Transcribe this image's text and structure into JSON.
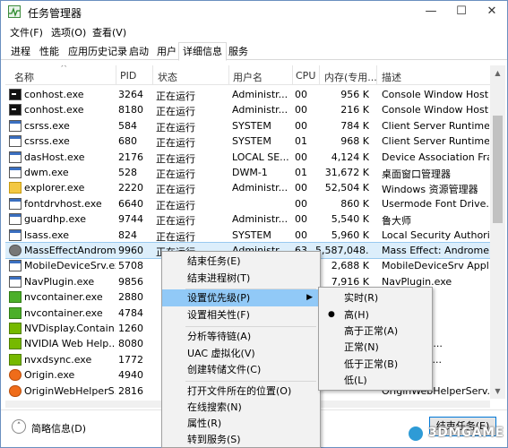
{
  "window": {
    "title": "任务管理器",
    "controls": [
      "—",
      "☐",
      "✕"
    ]
  },
  "menubar": [
    "文件(F)",
    "选项(O)",
    "查看(V)"
  ],
  "tabs": [
    "进程",
    "性能",
    "应用历史记录",
    "启动",
    "用户",
    "详细信息",
    "服务"
  ],
  "active_tab": "详细信息",
  "columns": [
    "名称",
    "PID",
    "状态",
    "用户名",
    "CPU",
    "内存(专用...",
    "描述"
  ],
  "rows": [
    {
      "icon": "console",
      "name": "conhost.exe",
      "pid": "3264",
      "status": "正在运行",
      "user": "Administr...",
      "cpu": "00",
      "mem": "956 K",
      "desc": "Console Window Host"
    },
    {
      "icon": "console",
      "name": "conhost.exe",
      "pid": "8180",
      "status": "正在运行",
      "user": "Administr...",
      "cpu": "00",
      "mem": "216 K",
      "desc": "Console Window Host"
    },
    {
      "icon": "box",
      "name": "csrss.exe",
      "pid": "584",
      "status": "正在运行",
      "user": "SYSTEM",
      "cpu": "00",
      "mem": "784 K",
      "desc": "Client Server Runtime ..."
    },
    {
      "icon": "box",
      "name": "csrss.exe",
      "pid": "680",
      "status": "正在运行",
      "user": "SYSTEM",
      "cpu": "01",
      "mem": "968 K",
      "desc": "Client Server Runtime ..."
    },
    {
      "icon": "box",
      "name": "dasHost.exe",
      "pid": "2176",
      "status": "正在运行",
      "user": "LOCAL SE...",
      "cpu": "00",
      "mem": "4,124 K",
      "desc": "Device Association Fra..."
    },
    {
      "icon": "box",
      "name": "dwm.exe",
      "pid": "528",
      "status": "正在运行",
      "user": "DWM-1",
      "cpu": "01",
      "mem": "31,672 K",
      "desc": "桌面窗口管理器"
    },
    {
      "icon": "folder",
      "name": "explorer.exe",
      "pid": "2220",
      "status": "正在运行",
      "user": "Administr...",
      "cpu": "00",
      "mem": "52,504 K",
      "desc": "Windows 资源管理器"
    },
    {
      "icon": "box",
      "name": "fontdrvhost.exe",
      "pid": "6640",
      "status": "正在运行",
      "user": "",
      "cpu": "00",
      "mem": "860 K",
      "desc": "Usermode Font Drive..."
    },
    {
      "icon": "box",
      "name": "guardhp.exe",
      "pid": "9744",
      "status": "正在运行",
      "user": "Administr...",
      "cpu": "00",
      "mem": "5,540 K",
      "desc": "鲁大师"
    },
    {
      "icon": "box",
      "name": "lsass.exe",
      "pid": "824",
      "status": "正在运行",
      "user": "SYSTEM",
      "cpu": "00",
      "mem": "5,960 K",
      "desc": "Local Security Authori..."
    },
    {
      "icon": "round",
      "name": "MassEffectAndrom...",
      "pid": "9960",
      "status": "正在运行",
      "user": "Administr...",
      "cpu": "63",
      "mem": "5,587,048...",
      "desc": "Mass Effect: Androme...",
      "selected": true
    },
    {
      "icon": "box",
      "name": "MobileDeviceSrv.exe",
      "pid": "5708",
      "status": "",
      "user": "",
      "cpu": "",
      "mem": "2,688 K",
      "desc": "MobileDeviceSrv Appl..."
    },
    {
      "icon": "box",
      "name": "NavPlugin.exe",
      "pid": "9856",
      "status": "",
      "user": "",
      "cpu": "",
      "mem": "7,916 K",
      "desc": "NavPlugin.exe"
    },
    {
      "icon": "green",
      "name": "nvcontainer.exe",
      "pid": "2880",
      "status": "",
      "user": "",
      "cpu": "",
      "mem": "",
      "desc": "ntainer"
    },
    {
      "icon": "green",
      "name": "nvcontainer.exe",
      "pid": "4784",
      "status": "",
      "user": "",
      "cpu": "",
      "mem": "",
      "desc": "ntainer"
    },
    {
      "icon": "nvidia",
      "name": "NVDisplay.Contain...",
      "pid": "1260",
      "status": "",
      "user": "",
      "cpu": "",
      "mem": "",
      "desc": "ntainer"
    },
    {
      "icon": "nvidia",
      "name": "NVIDIA Web Help...",
      "pid": "8080",
      "status": "",
      "user": "",
      "cpu": "",
      "mem": "",
      "desc": "b Helper S..."
    },
    {
      "icon": "nvidia",
      "name": "nvxdsync.exe",
      "pid": "1772",
      "status": "",
      "user": "",
      "cpu": "",
      "mem": "",
      "desc": "r Experien..."
    },
    {
      "icon": "orange",
      "name": "Origin.exe",
      "pid": "4940",
      "status": "",
      "user": "",
      "cpu": "",
      "mem": "",
      "desc": ""
    },
    {
      "icon": "orange",
      "name": "OriginWebHelperS...",
      "pid": "2816",
      "status": "",
      "user": "",
      "cpu": "",
      "mem": "",
      "desc": "OriginWebHelperServ..."
    }
  ],
  "context_menu": {
    "items": [
      "结束任务(E)",
      "结束进程树(T)",
      "",
      "设置优先级(P)",
      "设置相关性(F)",
      "",
      "分析等待链(A)",
      "UAC 虚拟化(V)",
      "创建转储文件(C)",
      "",
      "打开文件所在的位置(O)",
      "在线搜索(N)",
      "属性(R)",
      "转到服务(S)"
    ],
    "highlighted": "设置优先级(P)"
  },
  "priority_menu": {
    "items": [
      "实时(R)",
      "高(H)",
      "高于正常(A)",
      "正常(N)",
      "低于正常(B)",
      "低(L)"
    ],
    "checked": "高(H)"
  },
  "footer": {
    "details_label": "简略信息(D)",
    "end_task_label": "结束任务(E)"
  },
  "watermark": "3DMGAME"
}
